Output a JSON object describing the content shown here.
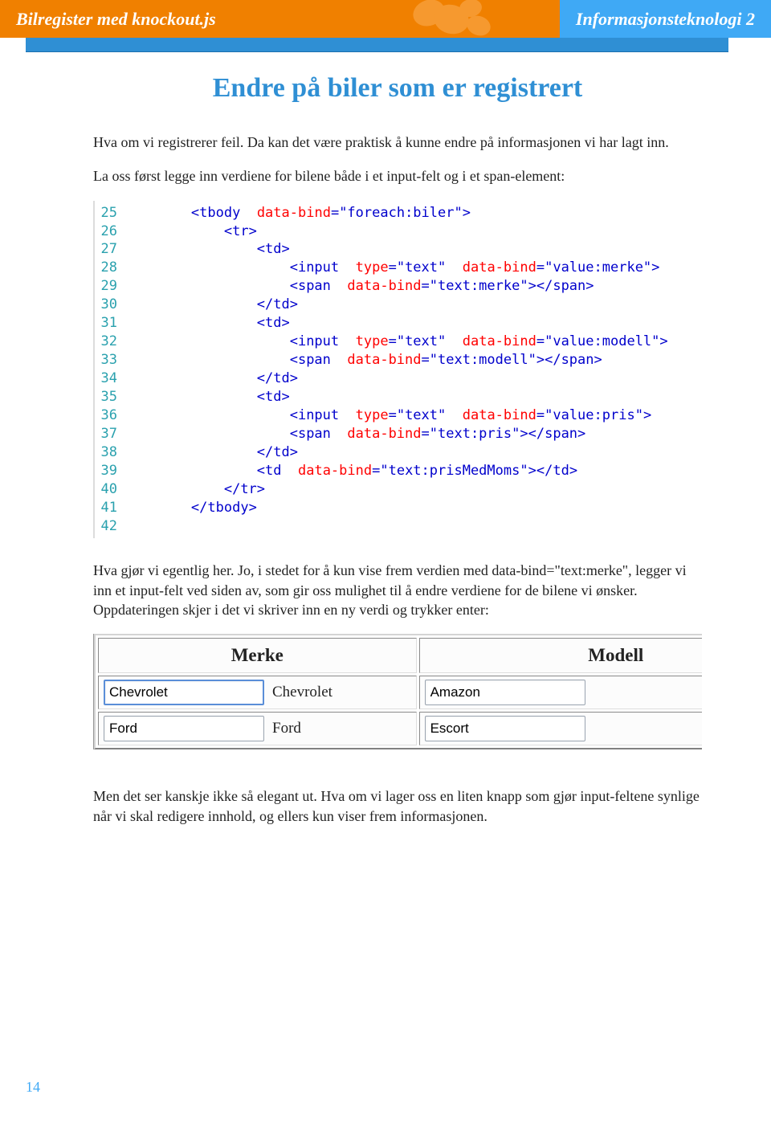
{
  "header": {
    "left": "Bilregister med knockout.js",
    "right": "Informasjonsteknologi 2"
  },
  "title": "Endre på biler som er registrert",
  "paragraphs": {
    "p1": "Hva om vi registrerer feil. Da kan det være praktisk å kunne endre på informasjonen vi har lagt inn.",
    "p2": "La oss først legge inn verdiene for bilene både i et input-felt og i et span-element:",
    "p3": "Hva gjør vi egentlig her. Jo, i stedet for å kun vise frem verdien med data-bind=\"text:merke\", legger vi inn et input-felt ved siden av, som gir oss mulighet til å endre verdiene for de bilene vi ønsker. Oppdateringen skjer i det vi skriver inn en ny verdi og trykker enter:",
    "p4": "Men det ser kanskje ikke så elegant ut. Hva om vi lager oss en liten knapp som gjør input-feltene synlige når vi skal redigere innhold, og ellers kun viser frem informasjonen."
  },
  "code": {
    "lines": [
      {
        "n": "25",
        "indent": "        ",
        "raw": "<tbody data-bind=\"foreach:biler\">"
      },
      {
        "n": "26",
        "indent": "            ",
        "raw": "<tr>"
      },
      {
        "n": "27",
        "indent": "                ",
        "raw": "<td>"
      },
      {
        "n": "28",
        "indent": "                    ",
        "raw": "<input type=\"text\" data-bind=\"value:merke\">"
      },
      {
        "n": "29",
        "indent": "                    ",
        "raw": "<span data-bind=\"text:merke\"></span>"
      },
      {
        "n": "30",
        "indent": "                ",
        "raw": "</td>"
      },
      {
        "n": "31",
        "indent": "                ",
        "raw": "<td>"
      },
      {
        "n": "32",
        "indent": "                    ",
        "raw": "<input type=\"text\" data-bind=\"value:modell\">"
      },
      {
        "n": "33",
        "indent": "                    ",
        "raw": "<span data-bind=\"text:modell\"></span>"
      },
      {
        "n": "34",
        "indent": "                ",
        "raw": "</td>"
      },
      {
        "n": "35",
        "indent": "                ",
        "raw": "<td>"
      },
      {
        "n": "36",
        "indent": "                    ",
        "raw": "<input type=\"text\" data-bind=\"value:pris\">"
      },
      {
        "n": "37",
        "indent": "                    ",
        "raw": "<span data-bind=\"text:pris\"></span>"
      },
      {
        "n": "38",
        "indent": "                ",
        "raw": "</td>"
      },
      {
        "n": "39",
        "indent": "                ",
        "raw": "<td data-bind=\"text:prisMedMoms\"></td>"
      },
      {
        "n": "40",
        "indent": "            ",
        "raw": "</tr>"
      },
      {
        "n": "41",
        "indent": "        ",
        "raw": "</tbody>"
      },
      {
        "n": "42",
        "indent": "",
        "raw": ""
      }
    ]
  },
  "table": {
    "headers": [
      "Merke",
      "Modell"
    ],
    "rows": [
      {
        "merke_input": "Chevrolet",
        "merke_text": "Chevrolet",
        "modell_input": "Amazon",
        "focus": true
      },
      {
        "merke_input": "Ford",
        "merke_text": "Ford",
        "modell_input": "Escort",
        "focus": false
      }
    ]
  },
  "page_number": "14"
}
